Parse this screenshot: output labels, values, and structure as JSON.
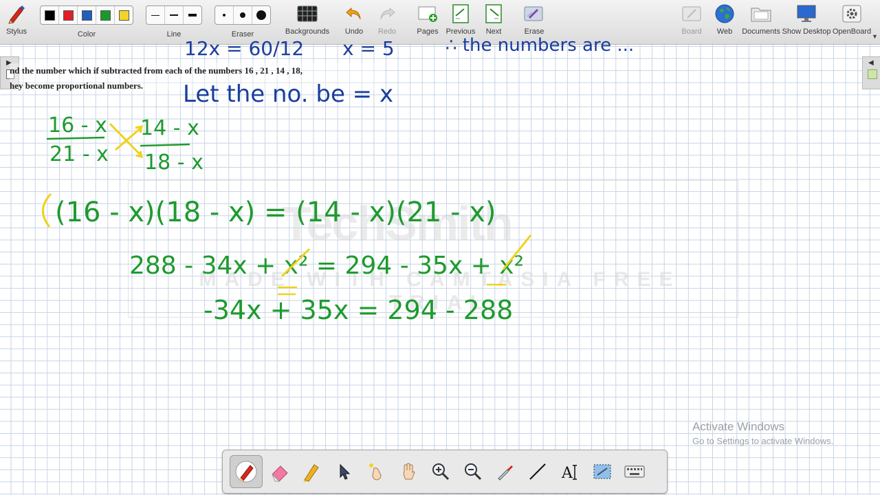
{
  "toolbar": {
    "stylus": "Stylus",
    "color": "Color",
    "line": "Line",
    "eraser": "Eraser",
    "backgrounds": "Backgrounds",
    "undo": "Undo",
    "redo": "Redo",
    "pages": "Pages",
    "previous": "Previous",
    "next": "Next",
    "erase": "Erase",
    "board": "Board",
    "web": "Web",
    "documents": "Documents",
    "show_desktop": "Show Desktop",
    "openboard": "OpenBoard"
  },
  "colors": {
    "palette": [
      "#000000",
      "#e31e24",
      "#1f5fbf",
      "#1a9a2a",
      "#f5d327"
    ],
    "ink_green": "#1e9a2e",
    "ink_blue": "#1a3e9e",
    "ink_yellow": "#f0d21a"
  },
  "canvas": {
    "question_line1": "nd the number which if subtracted from each of the numbers 16 , 21 , 14 , 18,",
    "question_line2": "hey become proportional numbers.",
    "top_partial_left": "12x = 60/12",
    "top_partial_mid": "x = 5",
    "top_partial_right": "∴ the numbers are ...",
    "let_statement": "Let the no. be = x",
    "proportion": {
      "num_left": "16 - x",
      "den_left": "21 - x",
      "num_right": "14 - x",
      "den_right": "18 - x"
    },
    "cross_multiply": "(16 - x)(18 - x) = (14 - x)(21 - x)",
    "expanded": "288 - 34x + x² = 294 - 35x + x²",
    "simplified": "-34x + 35x = 294 - 288"
  },
  "watermark": {
    "brand": "TechSmith",
    "trial": "MADE WITH CAMTASIA FREE TRIAL"
  },
  "activation": {
    "title": "Activate Windows",
    "subtitle": "Go to Settings to activate Windows."
  },
  "dock_tools": [
    "pen",
    "eraser",
    "highlighter",
    "pointer",
    "laser",
    "hand",
    "zoom-in",
    "zoom-out",
    "color-picker",
    "line",
    "text",
    "capture",
    "keyboard"
  ]
}
